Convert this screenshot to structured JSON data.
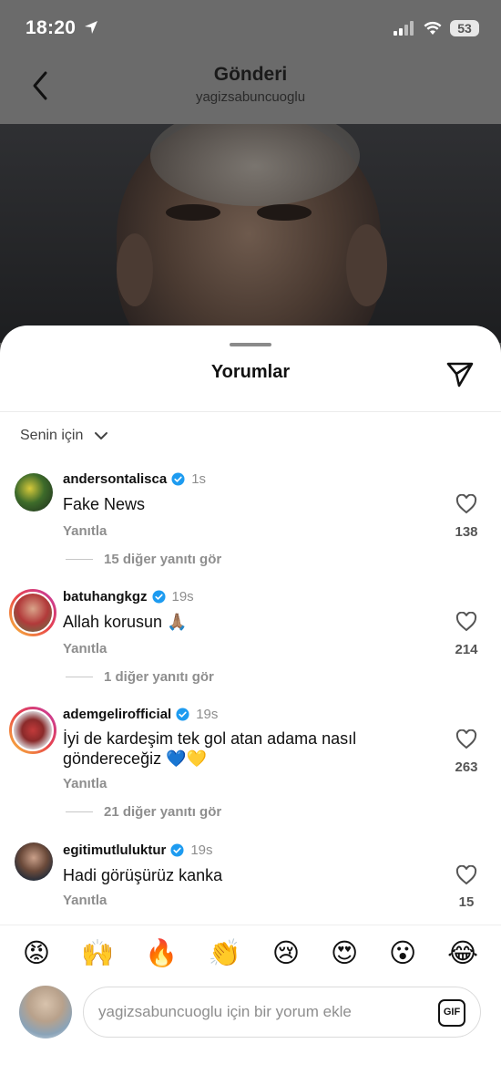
{
  "status": {
    "time": "18:20",
    "battery": "53"
  },
  "header": {
    "title": "Gönderi",
    "subtitle": "yagizsabuncuoglu"
  },
  "sheet": {
    "title": "Yorumlar",
    "filter_label": "Senin için"
  },
  "comments": [
    {
      "username": "andersontalisca",
      "verified": true,
      "time": "1s",
      "text": "Fake News",
      "reply": "Yanıtla",
      "likes": "138",
      "more_replies": "15 diğer yanıtı gör"
    },
    {
      "username": "batuhangkgz",
      "verified": true,
      "time": "19s",
      "text": "Allah korusun 🙏🏽",
      "reply": "Yanıtla",
      "likes": "214",
      "more_replies": "1 diğer yanıtı gör"
    },
    {
      "username": "ademgelirofficial",
      "verified": true,
      "time": "19s",
      "text": "İyi de kardeşim tek gol atan adama nasıl göndereceğiz 💙💛",
      "reply": "Yanıtla",
      "likes": "263",
      "more_replies": "21 diğer yanıtı gör"
    },
    {
      "username": "egitimutluluktur",
      "verified": true,
      "time": "19s",
      "text": "Hadi görüşürüz kanka",
      "reply": "Yanıtla",
      "likes": "15"
    }
  ],
  "emoji_bar": [
    "😡",
    "🙌",
    "🔥",
    "👏",
    "😢",
    "😍",
    "😮",
    "😂"
  ],
  "composer": {
    "placeholder": "yagizsabuncuoglu için bir yorum ekle",
    "gif_label": "GIF"
  },
  "colors": {
    "verified": "#1d9bf0",
    "secondary_text": "#8e8e8e",
    "dim_overlay": "#6b6b6b"
  }
}
